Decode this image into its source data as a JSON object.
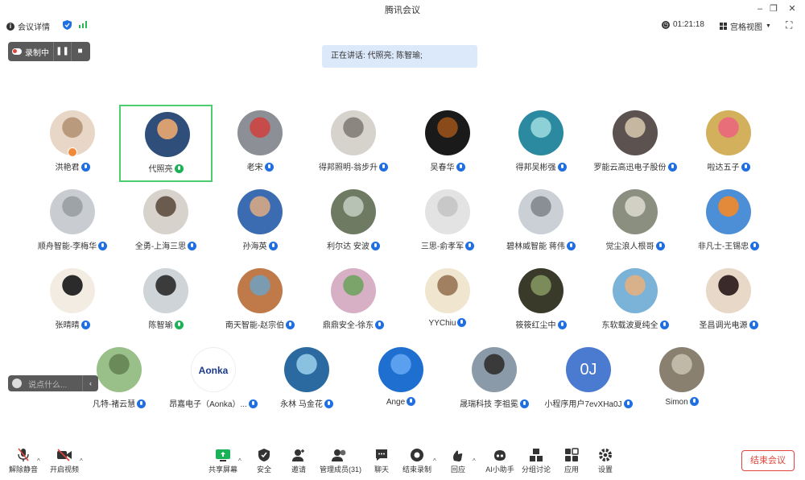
{
  "window": {
    "title": "腾讯会议"
  },
  "top_toolbar": {
    "meeting_info": "会议详情",
    "timer": "01:21:18",
    "view_mode": "宫格视图"
  },
  "recording": {
    "label": "录制中"
  },
  "speaking": {
    "text": "正在讲话: 代照亮; 陈智瑜;"
  },
  "participants": [
    {
      "name": "洪艳君",
      "host": true
    },
    {
      "name": "代照亮",
      "speaking": true
    },
    {
      "name": "老宋"
    },
    {
      "name": "得邦照明-翁步升"
    },
    {
      "name": "吴春华"
    },
    {
      "name": "得邦吴彬强"
    },
    {
      "name": "罗能云高迅电子股份"
    },
    {
      "name": "啦达五子"
    },
    {
      "name": "顺舟智能-李梅华"
    },
    {
      "name": "全勇-上海三思"
    },
    {
      "name": "孙海英"
    },
    {
      "name": "利尔达 安波"
    },
    {
      "name": "三思-俞孝军"
    },
    {
      "name": "碧林威智能 蒋伟"
    },
    {
      "name": "觉尘浪人根哥"
    },
    {
      "name": "非凡士-王锡忠"
    },
    {
      "name": "张晴晴"
    },
    {
      "name": "陈智瑜",
      "speaking": true
    },
    {
      "name": "南天智能-赵宗伯"
    },
    {
      "name": "鼎鼎安全-徐东"
    },
    {
      "name": "YYChiu"
    },
    {
      "name": "筱筱红尘中"
    },
    {
      "name": "东软载波夏纯全"
    },
    {
      "name": "圣昌调光电源"
    },
    {
      "name": "凡特-褚云慧"
    },
    {
      "name": "昂嘉电子（Aonka）...",
      "logo_text": "Aonka"
    },
    {
      "name": "永林 马金花"
    },
    {
      "name": "Ange"
    },
    {
      "name": "晟瑞科技 李祖冕"
    },
    {
      "name": "小程序用户7evXHa0J",
      "initials": "0J"
    },
    {
      "name": "Simon"
    }
  ],
  "chat": {
    "placeholder": "说点什么..."
  },
  "bottom_toolbar": {
    "unmute": "解除静音",
    "video": "开启视频",
    "share": "共享屏幕",
    "security": "安全",
    "invite": "邀请",
    "manage": "管理成员(31)",
    "chat": "聊天",
    "end_record": "结束录制",
    "replay": "回应",
    "ai": "AI小助手",
    "breakout": "分组讨论",
    "apps": "应用",
    "settings": "设置",
    "end_meeting": "结束会议"
  },
  "colors": {
    "accent": "#1f6fe3",
    "active_border": "#4cce6e",
    "speaking_bg": "#dbe9fb",
    "end_red": "#e0443a"
  }
}
